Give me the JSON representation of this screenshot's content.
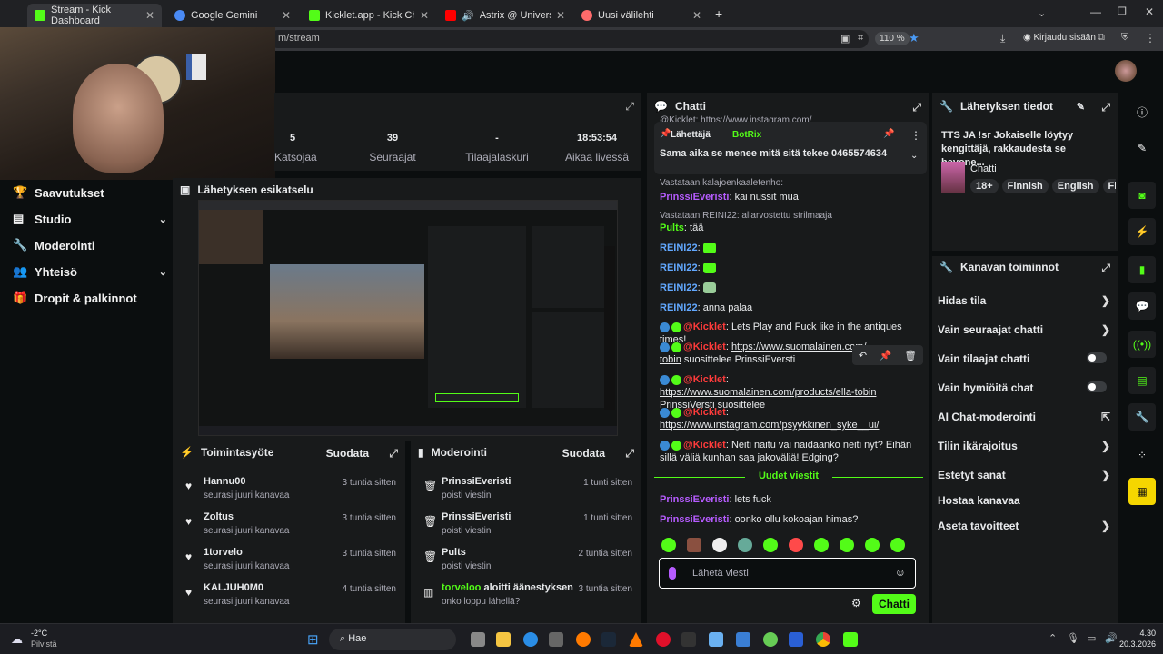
{
  "browser": {
    "tabs": [
      {
        "label": "Stream - Kick Dashboard",
        "active": true,
        "color": "#53fc18"
      },
      {
        "label": "Google Gemini",
        "active": false,
        "color": "#4a8af4"
      },
      {
        "label": "Kicklet.app - Kick Chatbot and (",
        "active": false,
        "color": "#53fc18"
      },
      {
        "label": "Astrix @ Universo Paralello",
        "active": false,
        "color": "#ff0000"
      },
      {
        "label": "Uusi välilehti",
        "active": false,
        "color": "#ff6b6b"
      }
    ],
    "url": "m/stream",
    "zoom": "110 %",
    "sign_in": "Kirjaudu sisään"
  },
  "sidebar": {
    "items": [
      {
        "label": "Saavutukset",
        "icon": "trophy-icon"
      },
      {
        "label": "Studio",
        "icon": "studio-icon",
        "chevron": true
      },
      {
        "label": "Moderointi",
        "icon": "wrench-icon"
      },
      {
        "label": "Yhteisö",
        "icon": "people-icon",
        "chevron": true
      },
      {
        "label": "Dropit & palkinnot",
        "icon": "gift-icon"
      }
    ]
  },
  "stats": {
    "viewers": {
      "value": "5",
      "label": "Katsojaa"
    },
    "followers": {
      "value": "39",
      "label": "Seuraajat"
    },
    "subs": {
      "value": "-",
      "label": "Tilaajalaskuri"
    },
    "uptime": {
      "value": "18:53:54",
      "label": "Aikaa livessä"
    }
  },
  "preview": {
    "title": "Lähetyksen esikatselu"
  },
  "activity": {
    "title": "Toimintasyöte",
    "filter": "Suodata",
    "rows": [
      {
        "name": "Hannu00",
        "sub": "seurasi juuri kanavaa",
        "time": "3 tuntia sitten"
      },
      {
        "name": "Zoltus",
        "sub": "seurasi juuri kanavaa",
        "time": "3 tuntia sitten"
      },
      {
        "name": "1torvelo",
        "sub": "seurasi juuri kanavaa",
        "time": "3 tuntia sitten"
      },
      {
        "name": "KALJUH0M0",
        "sub": "seurasi juuri kanavaa",
        "time": "4 tuntia sitten"
      }
    ]
  },
  "moderation": {
    "title": "Moderointi",
    "filter": "Suodata",
    "rows": [
      {
        "name": "PrinssiEveristi",
        "sub": "poisti viestin",
        "time": "1 tunti sitten",
        "icon": "trash-icon"
      },
      {
        "name": "PrinssiEveristi",
        "sub": "poisti viestin",
        "time": "1 tunti sitten",
        "icon": "trash-icon"
      },
      {
        "name": "Pults",
        "sub": "poisti viestin",
        "time": "2 tuntia sitten",
        "icon": "trash-icon"
      },
      {
        "name": "torveloo",
        "name_suffix": "aloitti äänestyksen",
        "sub": "onko loppu lähellä?",
        "time": "3 tuntia sitten",
        "icon": "poll-icon"
      }
    ]
  },
  "chat": {
    "title": "Chatti",
    "top_clip": "@Kicklet: https://www.instagram.com/",
    "pinned": {
      "by_label": "Lähettäjä",
      "by_user": "BotRix",
      "text": "Sama aika se menee mitä sitä tekee 0465574634"
    },
    "messages": [
      {
        "reply": "Vastataan kalajoenkaaletenho:",
        "user": "PrinssiEveristi",
        "text": "kai nussit mua"
      },
      {
        "reply": "Vastataan REINI22: allarvostettu strilmaaja",
        "user": "Pults",
        "text": "tää"
      },
      {
        "user": "REINI22",
        "text": ""
      },
      {
        "user": "REINI22",
        "text": ""
      },
      {
        "user": "REINI22",
        "text": ""
      },
      {
        "user": "REINI22",
        "text": "anna palaa"
      },
      {
        "user": "@Kicklet",
        "text": "Lets Play and Fuck like in the antiques times!"
      },
      {
        "user": "@Kicklet",
        "text": "https://www.suomalainen.com/",
        "text2": "tobin",
        "text3": "suosittelee PrinssiEversti"
      },
      {
        "user": "@Kicklet",
        "text": "https://www.suomalainen.com/products/ella-tobin",
        "text3": "PrinssiVersti suosittelee"
      },
      {
        "user": "@Kicklet",
        "text": "https://www.instagram.com/psyykkinen_syke__ui/"
      },
      {
        "user": "@Kicklet",
        "text": "Neiti naitu vai naidaanko neiti nyt? Eihän sillä väliä kunhan saa jakoväliä! Edging?"
      }
    ],
    "new_messages": "Uudet viestit",
    "new": [
      {
        "user": "PrinssiEveristi",
        "text": "lets fuck"
      },
      {
        "user": "PrinssiEveristi",
        "text": "oonko ollu kokoajan himas?"
      }
    ],
    "input_placeholder": "Lähetä viesti",
    "send": "Chatti"
  },
  "info": {
    "title": "Lähetyksen tiedot",
    "stream_title": "TTS JA !sr Jokaiselle löytyy kengittäjä, rakkaudesta se hevone...",
    "category": "Chatti",
    "tags": [
      "18+",
      "Finnish",
      "English",
      "Fi"
    ]
  },
  "actions": {
    "title": "Kanavan toiminnot",
    "items": [
      {
        "label": "Hidas tila",
        "ctl": "chevron"
      },
      {
        "label": "Vain seuraajat chatti",
        "ctl": "chevron"
      },
      {
        "label": "Vain tilaajat chatti",
        "ctl": "toggle"
      },
      {
        "label": "Vain hymiöitä chat",
        "ctl": "toggle"
      },
      {
        "label": "AI Chat-moderointi",
        "ctl": "external"
      },
      {
        "label": "Tilin ikärajoitus",
        "ctl": "chevron"
      },
      {
        "label": "Estetyt sanat",
        "ctl": "chevron"
      },
      {
        "label": "Hostaa kanavaa",
        "ctl": "none"
      },
      {
        "label": "Aseta tavoitteet",
        "ctl": "chevron"
      }
    ]
  },
  "taskbar": {
    "weather_temp": "-2°C",
    "weather_text": "Pilvistä",
    "search": "Hae",
    "time": "4.30",
    "date": "20.3.2026"
  }
}
